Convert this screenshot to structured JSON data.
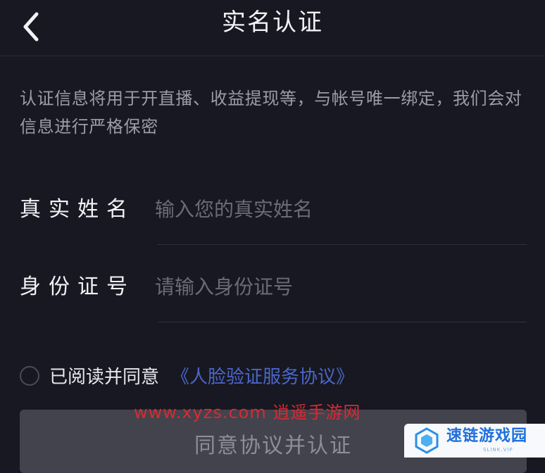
{
  "header": {
    "title": "实名认证",
    "back_icon": "chevron-left-icon"
  },
  "notice": "认证信息将用于开直播、收益提现等，与帐号唯一绑定，我们会对信息进行严格保密",
  "form": {
    "name_label": "真实姓名",
    "name_placeholder": "输入您的真实姓名",
    "id_label": "身份证号",
    "id_placeholder": "请输入身份证号"
  },
  "agreement": {
    "text": "已阅读并同意",
    "link": "《人脸验证服务协议》"
  },
  "submit_label": "同意协议并认证",
  "watermarks": {
    "site": "www.xyzs.com 逍遥手游网",
    "logo_text": "速链游戏园",
    "logo_sub": "SLINK.VIP"
  },
  "colors": {
    "background": "#171821",
    "link": "#4b66c8",
    "button_disabled": "#42434c",
    "watermark_red": "#d62b34",
    "logo_blue": "#1f6fdc"
  }
}
